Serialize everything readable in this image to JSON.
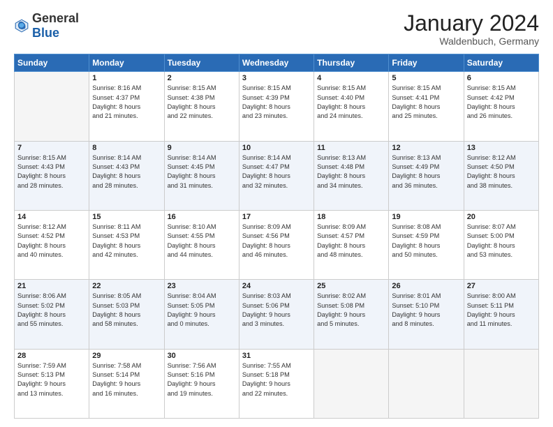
{
  "header": {
    "logo": {
      "general": "General",
      "blue": "Blue"
    },
    "title": "January 2024",
    "location": "Waldenbuch, Germany"
  },
  "weekdays": [
    "Sunday",
    "Monday",
    "Tuesday",
    "Wednesday",
    "Thursday",
    "Friday",
    "Saturday"
  ],
  "weeks": [
    [
      {
        "day": "",
        "info": ""
      },
      {
        "day": "1",
        "info": "Sunrise: 8:16 AM\nSunset: 4:37 PM\nDaylight: 8 hours\nand 21 minutes."
      },
      {
        "day": "2",
        "info": "Sunrise: 8:15 AM\nSunset: 4:38 PM\nDaylight: 8 hours\nand 22 minutes."
      },
      {
        "day": "3",
        "info": "Sunrise: 8:15 AM\nSunset: 4:39 PM\nDaylight: 8 hours\nand 23 minutes."
      },
      {
        "day": "4",
        "info": "Sunrise: 8:15 AM\nSunset: 4:40 PM\nDaylight: 8 hours\nand 24 minutes."
      },
      {
        "day": "5",
        "info": "Sunrise: 8:15 AM\nSunset: 4:41 PM\nDaylight: 8 hours\nand 25 minutes."
      },
      {
        "day": "6",
        "info": "Sunrise: 8:15 AM\nSunset: 4:42 PM\nDaylight: 8 hours\nand 26 minutes."
      }
    ],
    [
      {
        "day": "7",
        "info": ""
      },
      {
        "day": "8",
        "info": "Sunrise: 8:14 AM\nSunset: 4:43 PM\nDaylight: 8 hours\nand 28 minutes."
      },
      {
        "day": "9",
        "info": "Sunrise: 8:14 AM\nSunset: 4:45 PM\nDaylight: 8 hours\nand 31 minutes."
      },
      {
        "day": "10",
        "info": "Sunrise: 8:14 AM\nSunset: 4:47 PM\nDaylight: 8 hours\nand 32 minutes."
      },
      {
        "day": "11",
        "info": "Sunrise: 8:13 AM\nSunset: 4:48 PM\nDaylight: 8 hours\nand 34 minutes."
      },
      {
        "day": "12",
        "info": "Sunrise: 8:13 AM\nSunset: 4:49 PM\nDaylight: 8 hours\nand 36 minutes."
      },
      {
        "day": "13",
        "info": "Sunrise: 8:12 AM\nSunset: 4:50 PM\nDaylight: 8 hours\nand 38 minutes."
      }
    ],
    [
      {
        "day": "14",
        "info": ""
      },
      {
        "day": "15",
        "info": "Sunrise: 8:11 AM\nSunset: 4:53 PM\nDaylight: 8 hours\nand 42 minutes."
      },
      {
        "day": "16",
        "info": "Sunrise: 8:10 AM\nSunset: 4:55 PM\nDaylight: 8 hours\nand 44 minutes."
      },
      {
        "day": "17",
        "info": "Sunrise: 8:09 AM\nSunset: 4:56 PM\nDaylight: 8 hours\nand 46 minutes."
      },
      {
        "day": "18",
        "info": "Sunrise: 8:09 AM\nSunset: 4:57 PM\nDaylight: 8 hours\nand 48 minutes."
      },
      {
        "day": "19",
        "info": "Sunrise: 8:08 AM\nSunset: 4:59 PM\nDaylight: 8 hours\nand 50 minutes."
      },
      {
        "day": "20",
        "info": "Sunrise: 8:07 AM\nSunset: 5:00 PM\nDaylight: 8 hours\nand 53 minutes."
      }
    ],
    [
      {
        "day": "21",
        "info": ""
      },
      {
        "day": "22",
        "info": "Sunrise: 8:05 AM\nSunset: 5:03 PM\nDaylight: 8 hours\nand 58 minutes."
      },
      {
        "day": "23",
        "info": "Sunrise: 8:04 AM\nSunset: 5:05 PM\nDaylight: 9 hours\nand 0 minutes."
      },
      {
        "day": "24",
        "info": "Sunrise: 8:03 AM\nSunset: 5:06 PM\nDaylight: 9 hours\nand 3 minutes."
      },
      {
        "day": "25",
        "info": "Sunrise: 8:02 AM\nSunset: 5:08 PM\nDaylight: 9 hours\nand 5 minutes."
      },
      {
        "day": "26",
        "info": "Sunrise: 8:01 AM\nSunset: 5:10 PM\nDaylight: 9 hours\nand 8 minutes."
      },
      {
        "day": "27",
        "info": "Sunrise: 8:00 AM\nSunset: 5:11 PM\nDaylight: 9 hours\nand 11 minutes."
      }
    ],
    [
      {
        "day": "28",
        "info": ""
      },
      {
        "day": "29",
        "info": "Sunrise: 7:58 AM\nSunset: 5:14 PM\nDaylight: 9 hours\nand 16 minutes."
      },
      {
        "day": "30",
        "info": "Sunrise: 7:56 AM\nSunset: 5:16 PM\nDaylight: 9 hours\nand 19 minutes."
      },
      {
        "day": "31",
        "info": "Sunrise: 7:55 AM\nSunset: 5:18 PM\nDaylight: 9 hours\nand 22 minutes."
      },
      {
        "day": "",
        "info": ""
      },
      {
        "day": "",
        "info": ""
      },
      {
        "day": "",
        "info": ""
      }
    ]
  ],
  "week1_sunday": "Sunrise: 8:15 AM\nSunset: 4:43 PM\nDaylight: 8 hours\nand 28 minutes.",
  "week3_sunday": "Sunrise: 8:12 AM\nSunset: 4:52 PM\nDaylight: 8 hours\nand 40 minutes.",
  "week4_sunday": "Sunrise: 8:06 AM\nSunset: 5:02 PM\nDaylight: 8 hours\nand 55 minutes.",
  "week5_sunday": "Sunrise: 7:59 AM\nSunset: 5:13 PM\nDaylight: 9 hours\nand 13 minutes."
}
